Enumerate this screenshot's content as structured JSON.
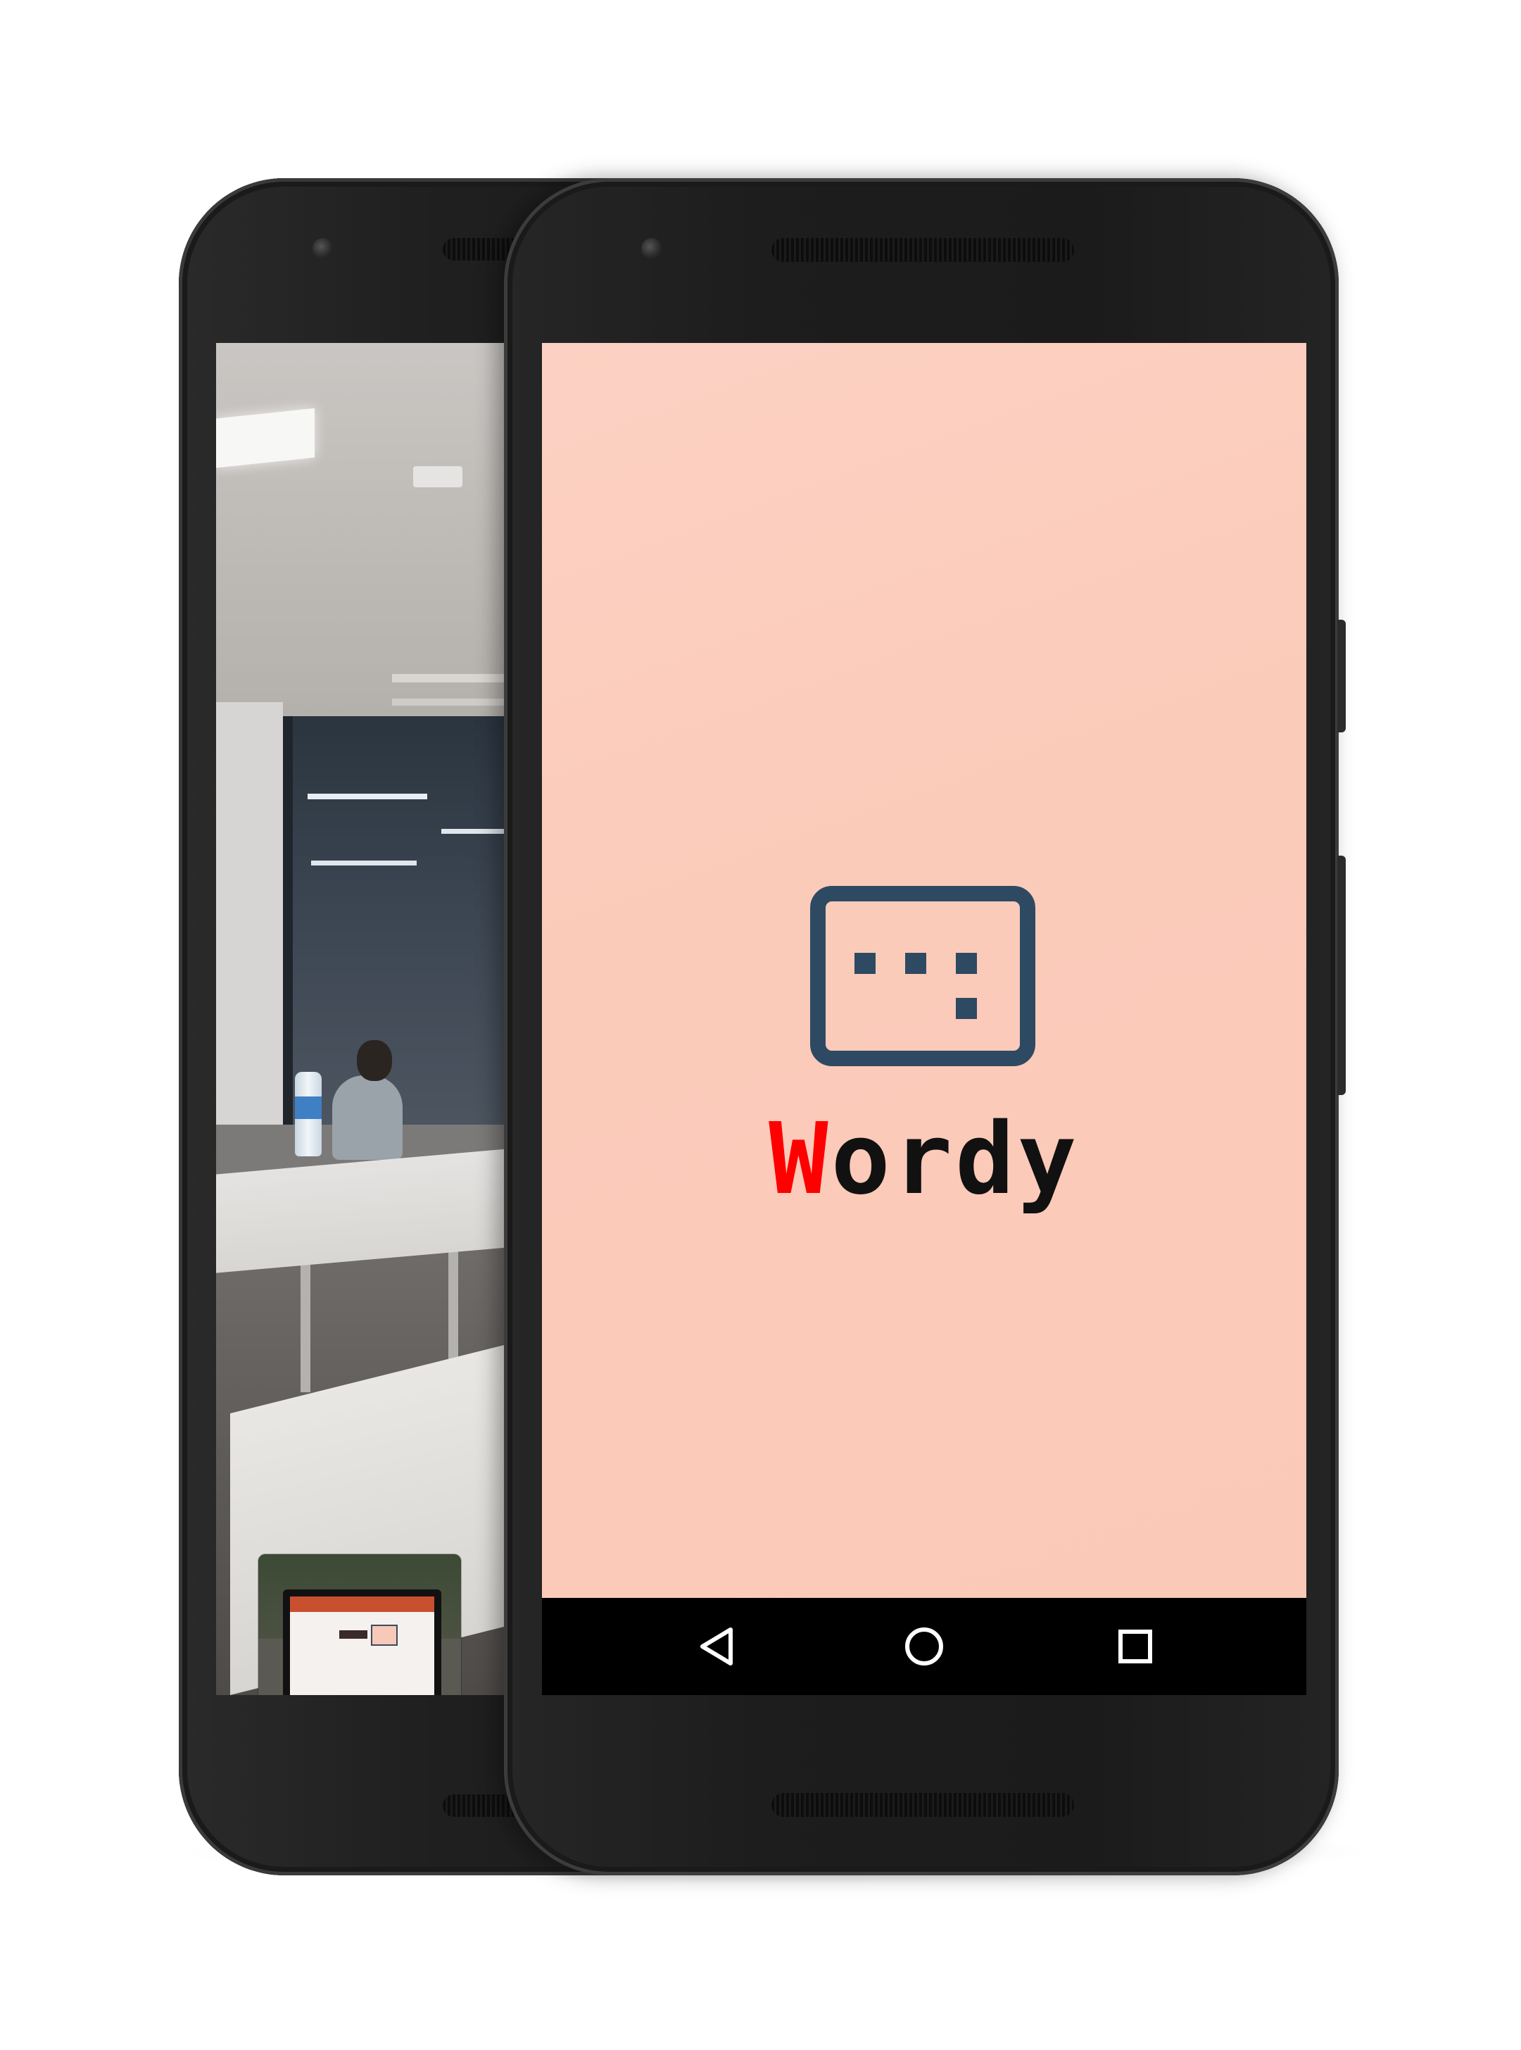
{
  "back_phone": {
    "camera_thumbnail": {
      "label": "mac"
    }
  },
  "front_phone": {
    "app": {
      "name_first_letter": "W",
      "name_rest": "ordy",
      "icon": "subtitles-icon",
      "background_color": "#fbcbbb",
      "icon_color": "#2e4a62",
      "name_accent_color": "#ff0000",
      "name_color": "#111111"
    },
    "nav_bar": {
      "back": "back-triangle-icon",
      "home": "home-circle-icon",
      "recents": "recents-square-icon"
    }
  }
}
